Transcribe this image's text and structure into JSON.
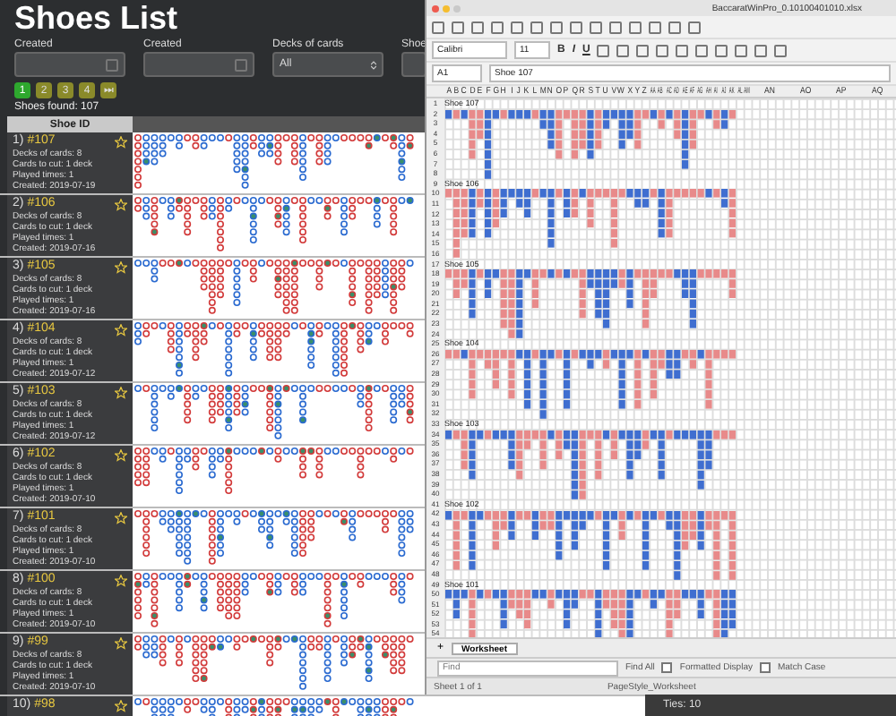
{
  "page": {
    "title": "Shoes List"
  },
  "filters": [
    {
      "kind": "date",
      "label": "Created"
    },
    {
      "kind": "date",
      "label": "Created"
    },
    {
      "kind": "select",
      "label": "Decks of cards",
      "value": "All"
    },
    {
      "kind": "select",
      "label": "Shoe"
    }
  ],
  "pagination": [
    {
      "label": "1",
      "selected": true
    },
    {
      "label": "2",
      "selected": false
    },
    {
      "label": "3",
      "selected": false
    },
    {
      "label": "4",
      "selected": false
    },
    {
      "label": "⏭",
      "selected": false
    }
  ],
  "found": "Shoes found: 107",
  "table": {
    "column": "Shoe ID",
    "rows": [
      {
        "number": "1)",
        "id": "#107",
        "lines": [
          "Decks of cards: 8",
          "Cards to cut: 1 deck",
          "Played times: 1",
          "Created: 2019-07-19"
        ]
      },
      {
        "number": "2)",
        "id": "#106",
        "lines": [
          "Decks of cards: 8",
          "Cards to cut: 1 deck",
          "Played times: 1",
          "Created: 2019-07-16"
        ]
      },
      {
        "number": "3)",
        "id": "#105",
        "lines": [
          "Decks of cards: 8",
          "Cards to cut: 1 deck",
          "Played times: 1",
          "Created: 2019-07-16"
        ]
      },
      {
        "number": "4)",
        "id": "#104",
        "lines": [
          "Decks of cards: 8",
          "Cards to cut: 1 deck",
          "Played times: 1",
          "Created: 2019-07-12"
        ]
      },
      {
        "number": "5)",
        "id": "#103",
        "lines": [
          "Decks of cards: 8",
          "Cards to cut: 1 deck",
          "Played times: 1",
          "Created: 2019-07-12"
        ]
      },
      {
        "number": "6)",
        "id": "#102",
        "lines": [
          "Decks of cards: 8",
          "Cards to cut: 1 deck",
          "Played times: 1",
          "Created: 2019-07-10"
        ]
      },
      {
        "number": "7)",
        "id": "#101",
        "lines": [
          "Decks of cards: 8",
          "Cards to cut: 1 deck",
          "Played times: 1",
          "Created: 2019-07-10"
        ]
      },
      {
        "number": "8)",
        "id": "#100",
        "lines": [
          "Decks of cards: 8",
          "Cards to cut: 1 deck",
          "Played times: 1",
          "Created: 2019-07-10"
        ]
      },
      {
        "number": "9)",
        "id": "#99",
        "lines": [
          "Decks of cards: 8",
          "Cards to cut: 1 deck",
          "Played times: 1",
          "Created: 2019-07-10"
        ]
      },
      {
        "number": "10)",
        "id": "#98",
        "lines": []
      }
    ]
  },
  "spreadsheet": {
    "title": "BaccaratWinPro_0.10100401010.xlsx",
    "font": "Calibri",
    "size": "11",
    "format_buttons": [
      "B",
      "I",
      "U"
    ],
    "cell": "A1",
    "formula": "Shoe 107",
    "columns": [
      "A",
      "B",
      "C",
      "D",
      "E",
      "F",
      "G",
      "H",
      "I",
      "J",
      "K",
      "L",
      "M",
      "N",
      "O",
      "P",
      "Q",
      "R",
      "S",
      "T",
      "U",
      "V",
      "W",
      "X",
      "Y",
      "Z",
      "AA",
      "AB",
      "AC",
      "AD",
      "AE",
      "AF",
      "AG",
      "AH",
      "AI",
      "AJ",
      "AK",
      "AL",
      "AM",
      "AN",
      "AO",
      "AP",
      "AQ"
    ],
    "row_numbers": [
      "1",
      "2",
      "3",
      "4",
      "5",
      "6",
      "7",
      "8",
      "9",
      "10",
      "11",
      "12",
      "13",
      "14",
      "15",
      "16",
      "17",
      "18",
      "19",
      "20",
      "21",
      "22",
      "23",
      "24",
      "25",
      "26",
      "27",
      "28",
      "29",
      "30",
      "31",
      "32",
      "33",
      "34",
      "35",
      "36",
      "37",
      "38",
      "39",
      "40",
      "41",
      "42",
      "43",
      "44",
      "45",
      "46",
      "47",
      "48",
      "49",
      "50",
      "51",
      "52",
      "53",
      "54"
    ],
    "blocks": [
      {
        "label": "Shoe 107"
      },
      {
        "label": "Shoe 106"
      },
      {
        "label": "Shoe 105"
      },
      {
        "label": "Shoe 104"
      },
      {
        "label": "Shoe 103"
      },
      {
        "label": "Shoe 102"
      },
      {
        "label": "Shoe 101"
      }
    ],
    "add_tab": "+",
    "sheet_tab": "Worksheet",
    "find": {
      "placeholder": "Find"
    },
    "find_all": "Find All",
    "options": [
      {
        "label": "Formatted Display",
        "checked": false
      },
      {
        "label": "Match Case",
        "checked": false
      }
    ],
    "status": [
      "Sheet 1 of 1",
      "PageStyle_Worksheet"
    ]
  },
  "background_window": {
    "text": "Ties: 10"
  }
}
